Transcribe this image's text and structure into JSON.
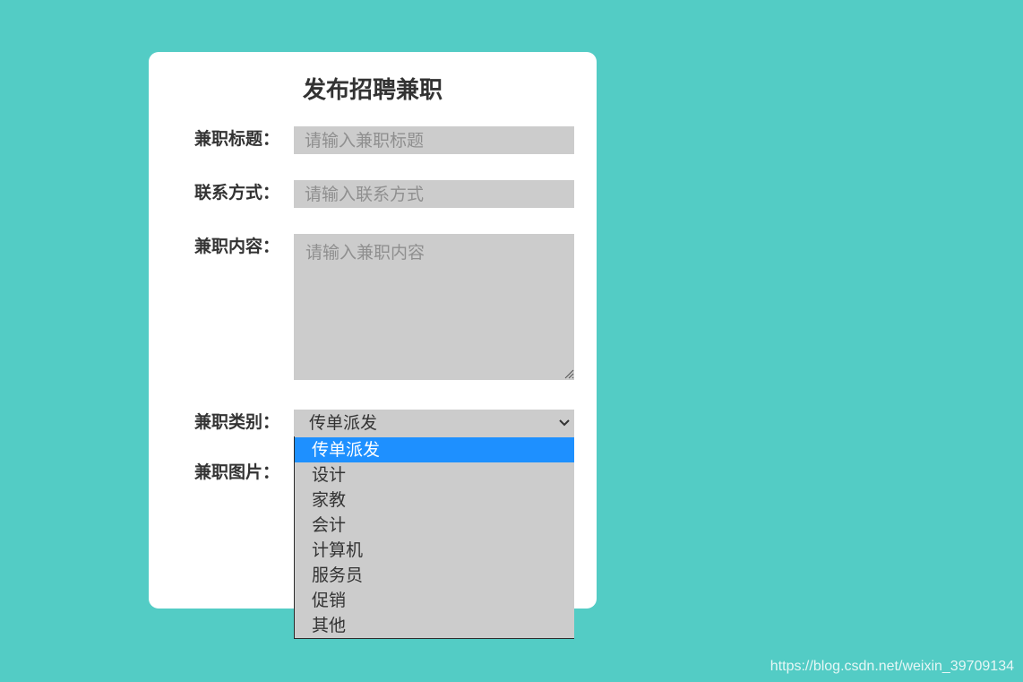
{
  "form": {
    "title": "发布招聘兼职",
    "job_title": {
      "label": "兼职标题：",
      "value": "",
      "placeholder": "请输入兼职标题"
    },
    "contact": {
      "label": "联系方式：",
      "value": "",
      "placeholder": "请输入联系方式"
    },
    "content": {
      "label": "兼职内容：",
      "value": "",
      "placeholder": "请输入兼职内容"
    },
    "category": {
      "label": "兼职类别：",
      "selected": "传单派发",
      "options": [
        "传单派发",
        "设计",
        "家教",
        "会计",
        "计算机",
        "服务员",
        "促销",
        "其他"
      ],
      "expanded": true
    },
    "image": {
      "label": "兼职图片："
    }
  },
  "watermark": "https://blog.csdn.net/weixin_39709134",
  "colors": {
    "page_background": "#53ccc5",
    "card_background": "#ffffff",
    "field_background": "#cccccc",
    "selected_option": "#1e90ff"
  },
  "icons": {
    "select_toggle": "chevron-down-icon",
    "textarea_resize": "resize-grip-icon"
  }
}
